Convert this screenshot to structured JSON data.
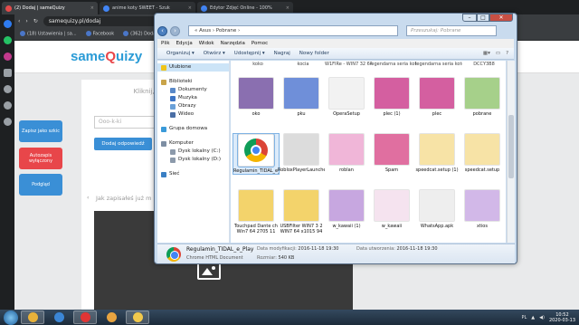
{
  "browser": {
    "tabs": [
      {
        "label": "(2) Dodaj | sameQuizy",
        "color": "#e34b4b",
        "active": true
      },
      {
        "label": "anime koty SWEET - Szuk",
        "color": "#4285f4",
        "active": false
      },
      {
        "label": "Edytor Zdjęć Online - 100%",
        "color": "#4285f4",
        "active": false
      }
    ],
    "address": "samequizy.pl/dodaj",
    "bookmarks": [
      "(18) Ustawienia | sa...",
      "Facebook",
      "(362) Dodaj"
    ]
  },
  "site": {
    "logo_part1": "same",
    "logo_part2": "Q",
    "logo_part3": "uizy",
    "hint": "Kliknij, aby do odpo",
    "input_placeholder": "Ooo-k-ki",
    "answer_button": "Dodaj odpowiedź",
    "section_text": "Jak zapisałeś już m",
    "side_buttons": [
      {
        "label": "Zapisz jako szkic",
        "color": "#3a8fd6"
      },
      {
        "label": "Autozapis wyłączony",
        "color": "#e8464a"
      },
      {
        "label": "Podgląd",
        "color": "#3a8fd6"
      }
    ]
  },
  "explorer": {
    "path": "« Asus › Pobrane ›",
    "search_placeholder": "Przeszukaj: Pobrane",
    "menu": [
      "Plik",
      "Edycja",
      "Widok",
      "Narzędzia",
      "Pomoc"
    ],
    "toolbar": [
      "Organizuj ▾",
      "Otwórz ▾",
      "Udostępnij ▾",
      "Nagraj",
      "Nowy folder"
    ],
    "nav": [
      {
        "label": "Ulubione",
        "level": 0,
        "color": "#f0c419",
        "selected": true
      },
      {
        "label": "",
        "level": -1
      },
      {
        "label": "Biblioteki",
        "level": 0,
        "color": "#c9a44a",
        "selected": false
      },
      {
        "label": "Dokumenty",
        "level": 1,
        "color": "#5a89c8",
        "selected": false
      },
      {
        "label": "Muzyka",
        "level": 1,
        "color": "#3d74c4",
        "selected": false
      },
      {
        "label": "Obrazy",
        "level": 1,
        "color": "#6aa0d8",
        "selected": false
      },
      {
        "label": "Wideo",
        "level": 1,
        "color": "#4a6ea5",
        "selected": false
      },
      {
        "label": "",
        "level": -1
      },
      {
        "label": "Grupa domowa",
        "level": 0,
        "color": "#3a9ad9",
        "selected": false
      },
      {
        "label": "",
        "level": -1
      },
      {
        "label": "Komputer",
        "level": 0,
        "color": "#7d8ea3",
        "selected": false
      },
      {
        "label": "Dysk lokalny (C:)",
        "level": 1,
        "color": "#8c9aab",
        "selected": false
      },
      {
        "label": "Dysk lokalny (D:)",
        "level": 1,
        "color": "#8c9aab",
        "selected": false
      },
      {
        "label": "",
        "level": -1
      },
      {
        "label": "Sieć",
        "level": 0,
        "color": "#3a7fc4",
        "selected": false
      }
    ],
    "top_strip": [
      "koko",
      "kocia",
      "W1FIRe - WIN7 32 64 x60171",
      "legendarna seria koteki (1)",
      "legendarna seria koteki",
      "DCCY3B8"
    ],
    "files": [
      {
        "name": "oko",
        "thumb": "#8a6fb0",
        "selected": false
      },
      {
        "name": "pku",
        "thumb": "#6f8fd9",
        "selected": false
      },
      {
        "name": "OperaSetup",
        "thumb": "#f2f2f2",
        "selected": false
      },
      {
        "name": "plec (1)",
        "thumb": "#d45fa0",
        "selected": false
      },
      {
        "name": "plec",
        "thumb": "#d45fa0",
        "selected": false
      },
      {
        "name": "pobrane",
        "thumb": "#a6d08a",
        "selected": false
      },
      {
        "name": "Regulamin_TIDAL_e_Play",
        "thumb": "#ffffff",
        "selected": true
      },
      {
        "name": "RobloxPlayerLauncher",
        "thumb": "#dcdcdc",
        "selected": false
      },
      {
        "name": "roblan",
        "thumb": "#f0b6d8",
        "selected": false
      },
      {
        "name": "Spam",
        "thumb": "#e06fa0",
        "selected": false
      },
      {
        "name": "speedcat.setup (1)",
        "thumb": "#f7e3a6",
        "selected": false
      },
      {
        "name": "speedcat.setup",
        "thumb": "#f7e3a6",
        "selected": false
      },
      {
        "name": "Touchpad Dante ch Win7 64 2705 11",
        "thumb": "#f3d36b",
        "selected": false
      },
      {
        "name": "USBFilter WIN7 3 2 WIN7 64 x1015 94",
        "thumb": "#f3d36b",
        "selected": false
      },
      {
        "name": "w_kawaii (1)",
        "thumb": "#c7a7e0",
        "selected": false
      },
      {
        "name": "w_kawaii",
        "thumb": "#f5e3ef",
        "selected": false
      },
      {
        "name": "WhatsApp.apk",
        "thumb": "#eeeeee",
        "selected": false
      },
      {
        "name": "xtios",
        "thumb": "#d2b8e8",
        "selected": false
      }
    ],
    "details": {
      "name": "Regulamin_TIDAL_e_Play",
      "type": "Chrome HTML Document",
      "modified_label": "Data modyfikacji:",
      "modified": "2016-11-18 19:30",
      "created_label": "Data utworzenia:",
      "created": "2016-11-18 19:30",
      "size_label": "Rozmiar:",
      "size": "540 KB"
    },
    "window_buttons": [
      "–",
      "□",
      "✕"
    ]
  },
  "taskbar": {
    "apps": [
      {
        "name": "chrome-icon",
        "color": "#e8b23a",
        "active": true
      },
      {
        "name": "ie-icon",
        "color": "#3b86d6",
        "active": false
      },
      {
        "name": "opera-icon",
        "color": "#e03535",
        "active": true
      },
      {
        "name": "media-icon",
        "color": "#e7a441",
        "active": false
      },
      {
        "name": "explorer-icon",
        "color": "#f2c94c",
        "active": true
      }
    ],
    "lang": "PL",
    "time": "10:52",
    "date": "2020-03-13"
  }
}
